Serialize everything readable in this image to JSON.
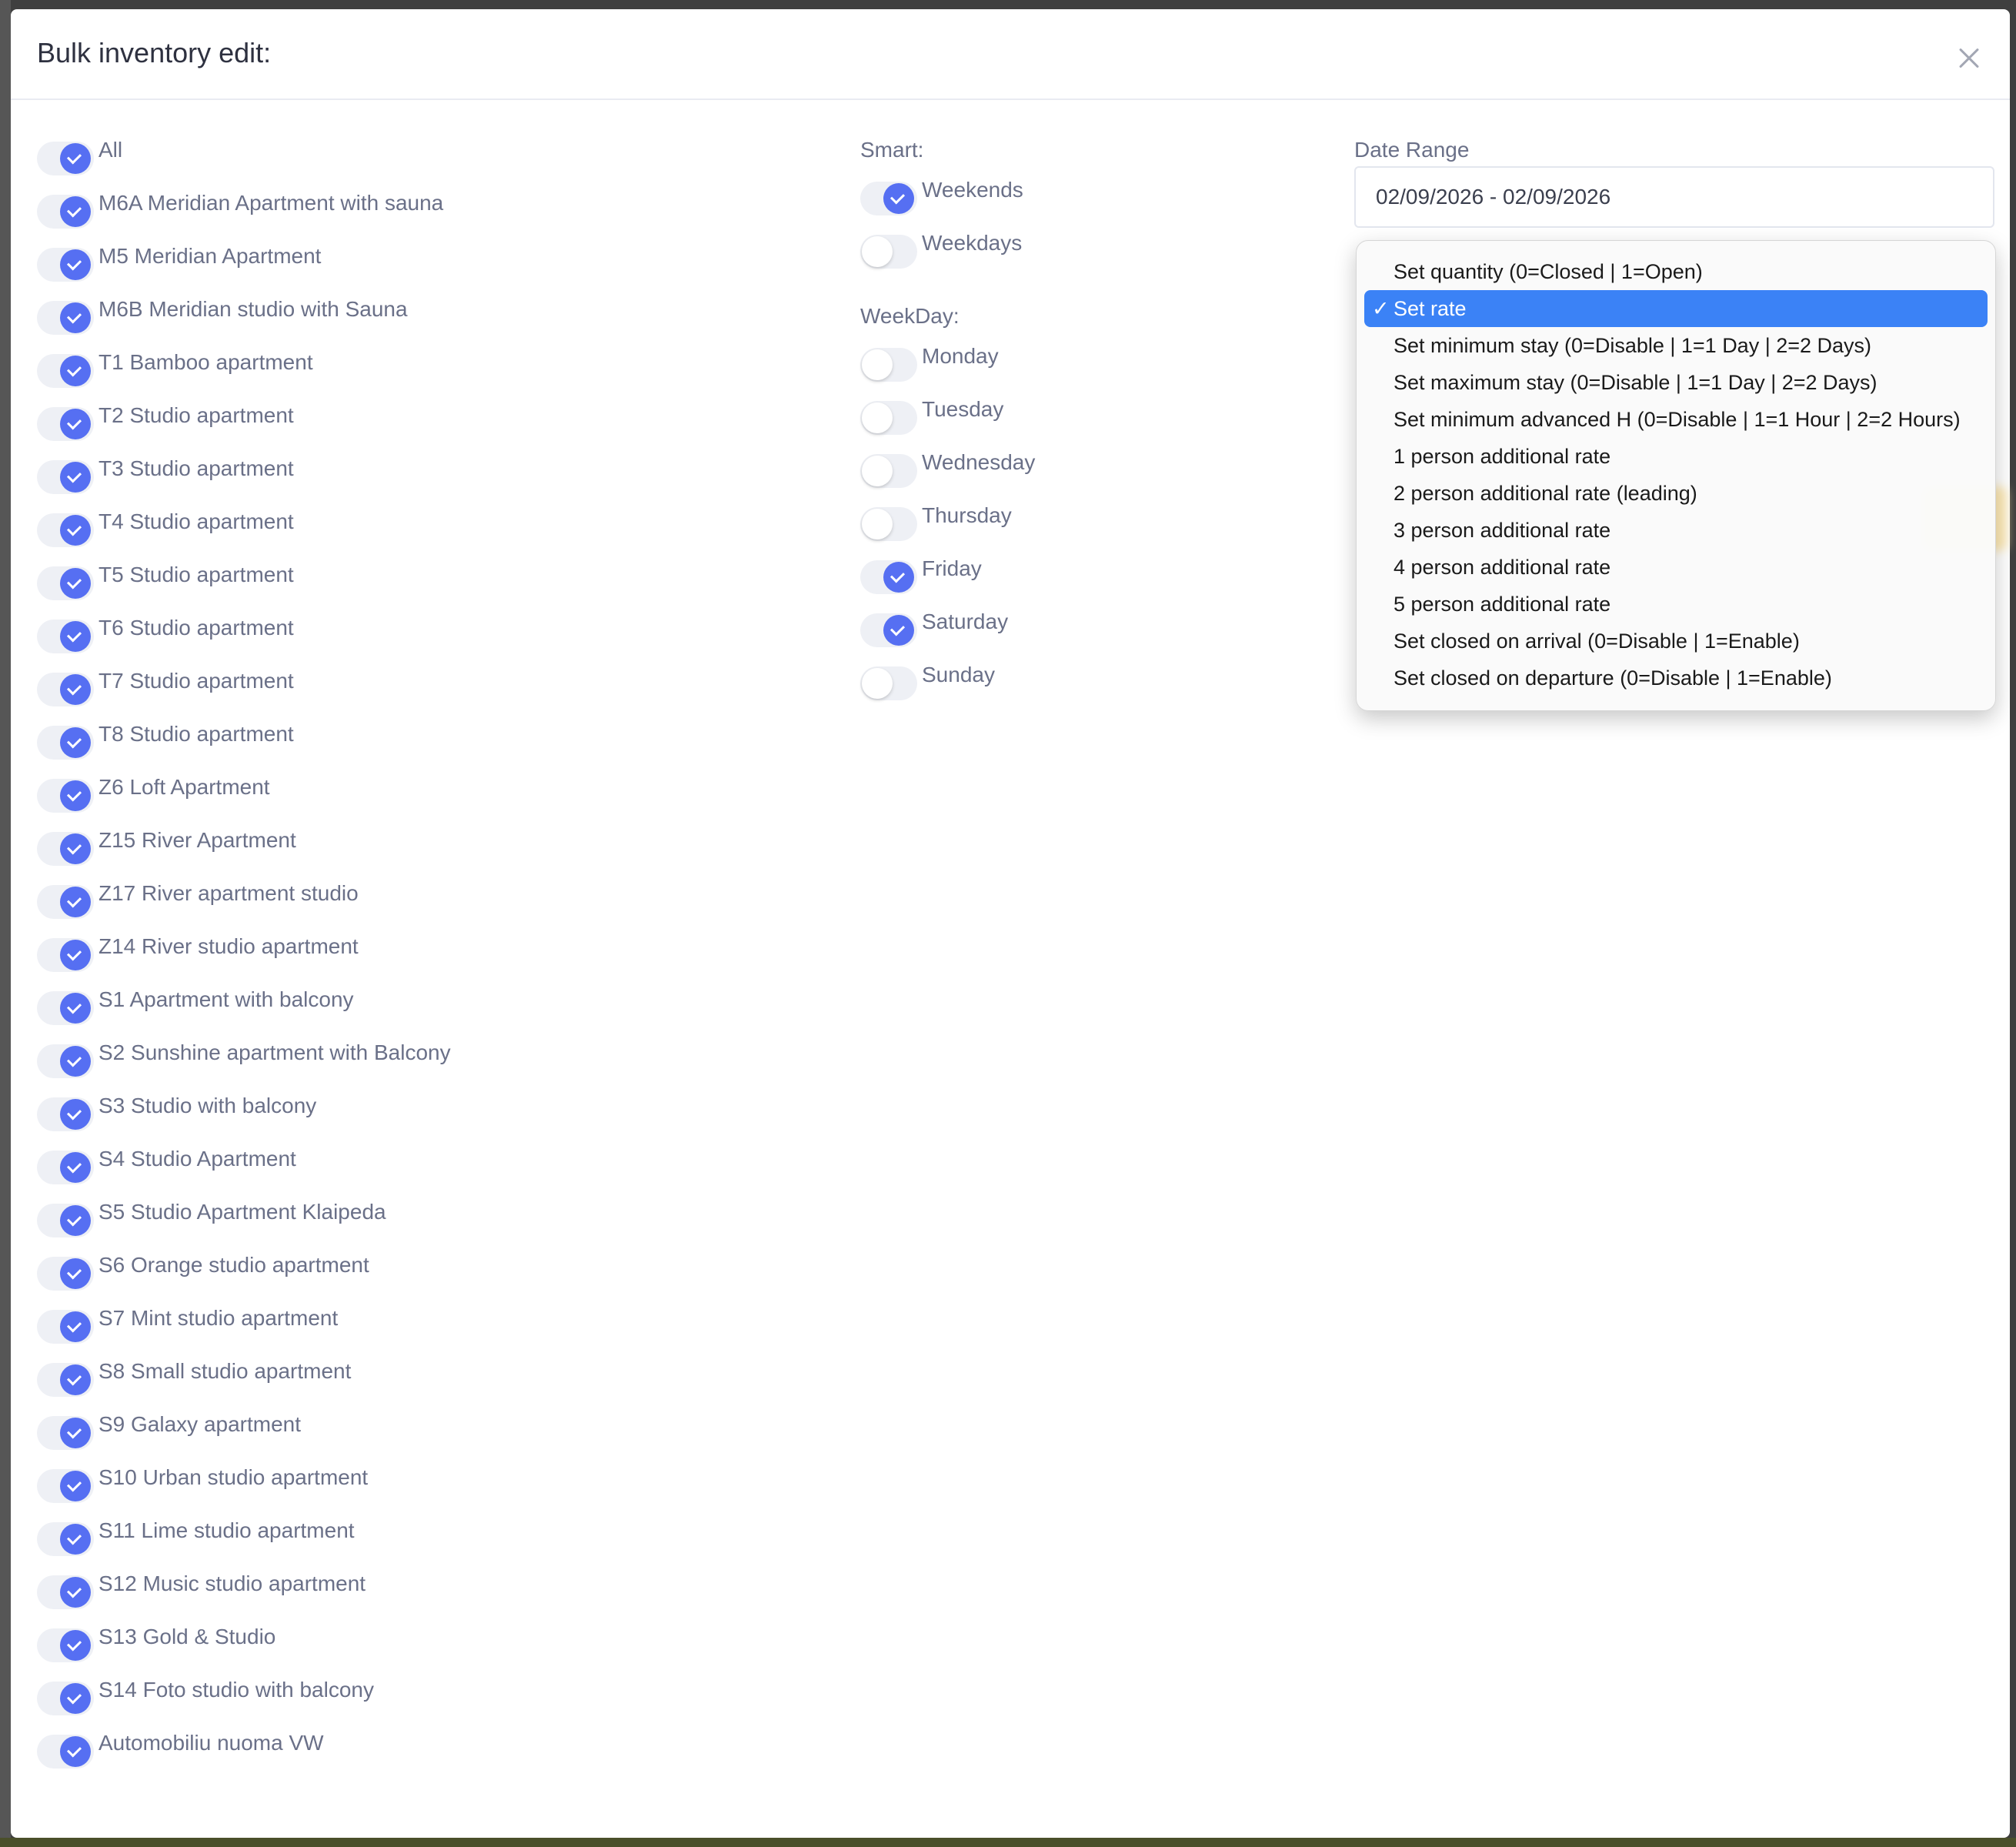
{
  "modal": {
    "title": "Bulk inventory edit:"
  },
  "properties": [
    {
      "label": "All",
      "on": true
    },
    {
      "label": "M6A Meridian Apartment with sauna",
      "on": true
    },
    {
      "label": "M5 Meridian Apartment",
      "on": true
    },
    {
      "label": "M6B Meridian studio with Sauna",
      "on": true
    },
    {
      "label": "T1 Bamboo apartment",
      "on": true
    },
    {
      "label": "T2 Studio apartment",
      "on": true
    },
    {
      "label": "T3 Studio apartment",
      "on": true
    },
    {
      "label": "T4 Studio apartment",
      "on": true
    },
    {
      "label": "T5 Studio apartment",
      "on": true
    },
    {
      "label": "T6 Studio apartment",
      "on": true
    },
    {
      "label": "T7 Studio apartment",
      "on": true
    },
    {
      "label": "T8 Studio apartment",
      "on": true
    },
    {
      "label": "Z6 Loft Apartment",
      "on": true
    },
    {
      "label": "Z15 River Apartment",
      "on": true
    },
    {
      "label": "Z17 River apartment studio",
      "on": true
    },
    {
      "label": "Z14 River studio apartment",
      "on": true
    },
    {
      "label": "S1 Apartment with balcony",
      "on": true
    },
    {
      "label": "S2 Sunshine apartment with Balcony",
      "on": true
    },
    {
      "label": "S3 Studio with balcony",
      "on": true
    },
    {
      "label": "S4 Studio Apartment",
      "on": true
    },
    {
      "label": "S5 Studio Apartment Klaipeda",
      "on": true
    },
    {
      "label": "S6 Orange studio apartment",
      "on": true
    },
    {
      "label": "S7 Mint studio apartment",
      "on": true
    },
    {
      "label": "S8 Small studio apartment",
      "on": true
    },
    {
      "label": "S9 Galaxy apartment",
      "on": true
    },
    {
      "label": "S10 Urban studio apartment",
      "on": true
    },
    {
      "label": "S11 Lime studio apartment",
      "on": true
    },
    {
      "label": "S12 Music studio apartment",
      "on": true
    },
    {
      "label": "S13 Gold & Studio",
      "on": true
    },
    {
      "label": "S14 Foto studio with balcony",
      "on": true
    },
    {
      "label": "Automobiliu nuoma VW",
      "on": true
    }
  ],
  "smart": {
    "label": "Smart:",
    "items": [
      {
        "label": "Weekends",
        "on": true
      },
      {
        "label": "Weekdays",
        "on": false
      }
    ]
  },
  "weekday": {
    "label": "WeekDay:",
    "items": [
      {
        "label": "Monday",
        "on": false
      },
      {
        "label": "Tuesday",
        "on": false
      },
      {
        "label": "Wednesday",
        "on": false
      },
      {
        "label": "Thursday",
        "on": false
      },
      {
        "label": "Friday",
        "on": true
      },
      {
        "label": "Saturday",
        "on": true
      },
      {
        "label": "Sunday",
        "on": false
      }
    ]
  },
  "date_range": {
    "label": "Date Range",
    "value": "02/09/2026 - 02/09/2026"
  },
  "action_dropdown": {
    "selected_index": 1,
    "options": [
      "Set quantity (0=Closed | 1=Open)",
      "Set rate",
      "Set minimum stay (0=Disable | 1=1 Day | 2=2 Days)",
      "Set maximum stay (0=Disable | 1=1 Day | 2=2 Days)",
      "Set minimum advanced H (0=Disable | 1=1 Hour | 2=2 Hours)",
      "1 person additional rate",
      "2 person additional rate (leading)",
      "3 person additional rate",
      "4 person additional rate",
      "5 person additional rate",
      "Set closed on arrival (0=Disable | 1=Enable)",
      "Set closed on departure (0=Disable | 1=Enable)"
    ]
  },
  "colors": {
    "accent": "#566ff2",
    "selected_option": "#3b82f6",
    "label_text": "#6a7088"
  }
}
